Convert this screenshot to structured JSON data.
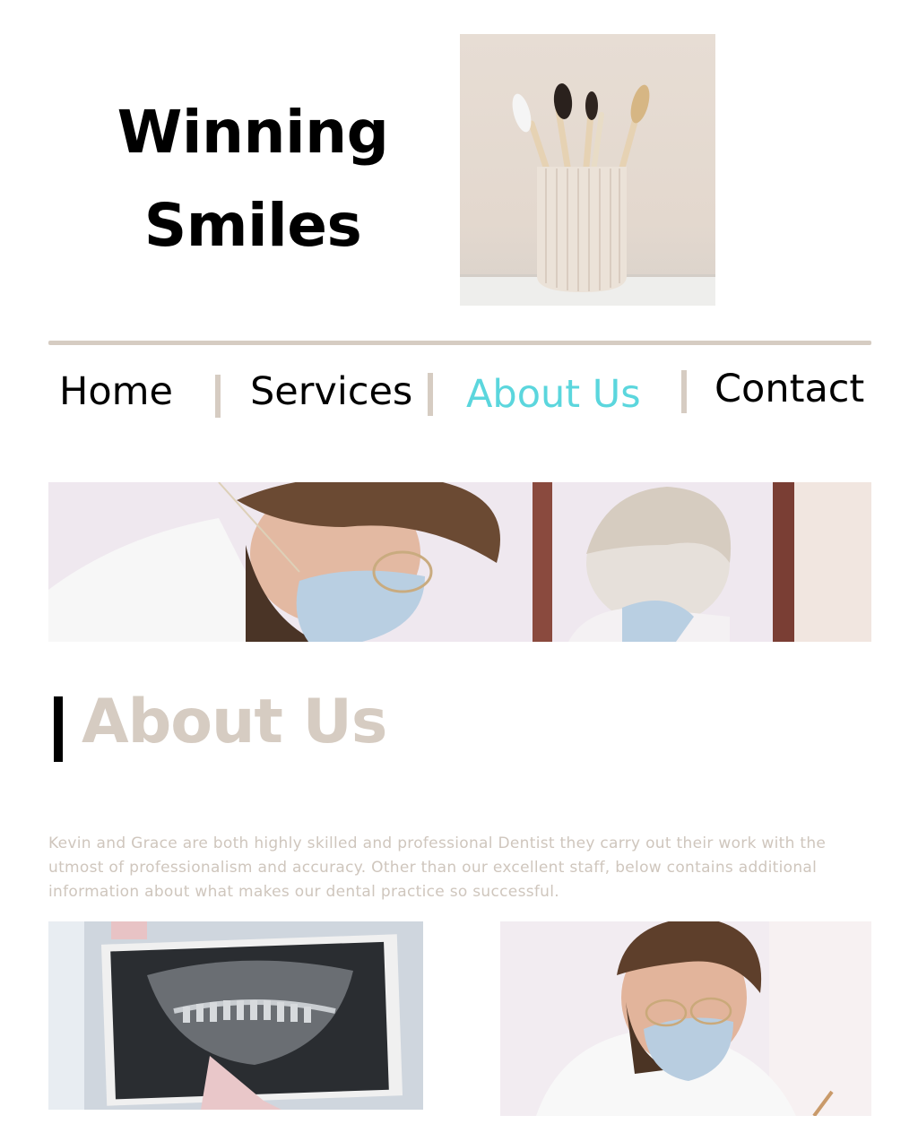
{
  "header": {
    "title_line1": "Winning",
    "title_line2": "Smiles"
  },
  "nav": {
    "items": [
      {
        "label": "Home"
      },
      {
        "label": "Services"
      },
      {
        "label": "About Us",
        "active": true
      },
      {
        "label": "Contact"
      }
    ],
    "active_color": "#5bd6dd",
    "separator_color": "#d6ccc2"
  },
  "about": {
    "heading": "About Us",
    "body": "Kevin and Grace are both highly skilled and professional Dentist they carry out their work with the utmost of professionalism and accuracy. Other than our excellent staff, below contains additional information about what makes our dental practice so successful."
  },
  "colors": {
    "accent_beige": "#d6ccc2",
    "body_text": "#cfc6bd",
    "active_nav": "#5bd6dd"
  }
}
